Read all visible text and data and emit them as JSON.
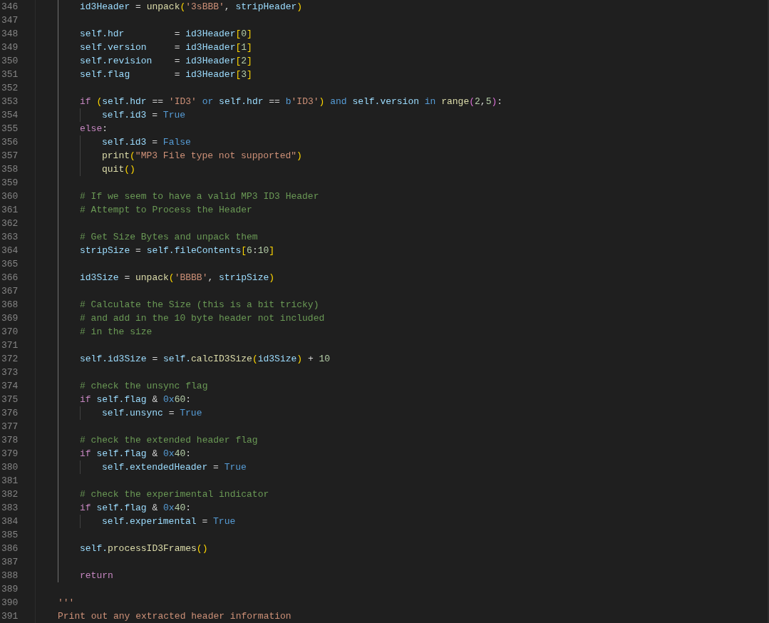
{
  "editor": {
    "lines": [
      {
        "children": [
          {
            "number": "346",
            "tokens": [
              {
                "text": "id3Header",
                "kind": "var"
              },
              {
                "text": " = ",
                "kind": "op"
              },
              {
                "text": "unpack",
                "kind": "func"
              },
              {
                "text": "(",
                "kind": "bracket"
              },
              {
                "text": "'3sBBB'",
                "kind": "string"
              },
              {
                "text": ", ",
                "kind": "op"
              },
              {
                "text": "stripHeader",
                "kind": "var"
              },
              {
                "text": ")",
                "kind": "bracket"
              }
            ]
          },
          {
            "number": "347"
          },
          {
            "number": "348",
            "tokens": [
              {
                "text": "self.hdr",
                "kind": "var"
              },
              {
                "text": "         = ",
                "kind": "op"
              },
              {
                "text": "id3Header",
                "kind": "var"
              },
              {
                "text": "[",
                "kind": "bracket"
              },
              {
                "text": "0",
                "kind": "number"
              },
              {
                "text": "]",
                "kind": "bracket"
              }
            ]
          },
          {
            "number": "349",
            "tokens": [
              {
                "text": "self.version",
                "kind": "var"
              },
              {
                "text": "     = ",
                "kind": "op"
              },
              {
                "text": "id3Header",
                "kind": "var"
              },
              {
                "text": "[",
                "kind": "bracket"
              },
              {
                "text": "1",
                "kind": "number"
              },
              {
                "text": "]",
                "kind": "bracket"
              }
            ]
          },
          {
            "number": "350",
            "tokens": [
              {
                "text": "self.revision",
                "kind": "var"
              },
              {
                "text": "    = ",
                "kind": "op"
              },
              {
                "text": "id3Header",
                "kind": "var"
              },
              {
                "text": "[",
                "kind": "bracket"
              },
              {
                "text": "2",
                "kind": "number"
              },
              {
                "text": "]",
                "kind": "bracket"
              }
            ]
          },
          {
            "number": "351",
            "tokens": [
              {
                "text": "self.flag",
                "kind": "var"
              },
              {
                "text": "        = ",
                "kind": "op"
              },
              {
                "text": "id3Header",
                "kind": "var"
              },
              {
                "text": "[",
                "kind": "bracket"
              },
              {
                "text": "3",
                "kind": "number"
              },
              {
                "text": "]",
                "kind": "bracket"
              }
            ]
          },
          {
            "number": "352"
          },
          {
            "number": "353",
            "tokens": [
              {
                "text": "if ",
                "kind": "control"
              },
              {
                "text": "(",
                "kind": "bracket"
              },
              {
                "text": "self.hdr",
                "kind": "var"
              },
              {
                "text": " == ",
                "kind": "op"
              },
              {
                "text": "'ID3' ",
                "kind": "string"
              },
              {
                "text": "or ",
                "kind": "keyword"
              },
              {
                "text": "self.hdr",
                "kind": "var"
              },
              {
                "text": " == ",
                "kind": "op"
              },
              {
                "text": "b",
                "kind": "keyword"
              },
              {
                "text": "'ID3'",
                "kind": "string"
              },
              {
                "text": ") ",
                "kind": "bracket"
              },
              {
                "text": "and ",
                "kind": "keyword"
              },
              {
                "text": "self.version ",
                "kind": "var"
              },
              {
                "text": "in ",
                "kind": "keyword"
              },
              {
                "text": "range",
                "kind": "func"
              },
              {
                "text": "(",
                "kind": "bracket2"
              },
              {
                "text": "2",
                "kind": "number"
              },
              {
                "text": ",",
                "kind": "op"
              },
              {
                "text": "5",
                "kind": "number"
              },
              {
                "text": ")",
                "kind": "bracket2"
              },
              {
                "text": ":",
                "kind": "op"
              }
            ],
            "children": [
              {
                "number": "354",
                "tokens": [
                  {
                    "text": "self.id3",
                    "kind": "var"
                  },
                  {
                    "text": " = ",
                    "kind": "op"
                  },
                  {
                    "text": "True",
                    "kind": "keyword"
                  }
                ]
              }
            ]
          },
          {
            "number": "355",
            "tokens": [
              {
                "text": "else",
                "kind": "control"
              },
              {
                "text": ":",
                "kind": "op"
              }
            ],
            "children": [
              {
                "number": "356",
                "tokens": [
                  {
                    "text": "self.id3",
                    "kind": "var"
                  },
                  {
                    "text": " = ",
                    "kind": "op"
                  },
                  {
                    "text": "False",
                    "kind": "keyword"
                  }
                ]
              },
              {
                "number": "357",
                "tokens": [
                  {
                    "text": "print",
                    "kind": "func"
                  },
                  {
                    "text": "(",
                    "kind": "bracket"
                  },
                  {
                    "text": "\"MP3 File type not supported\"",
                    "kind": "string"
                  },
                  {
                    "text": ")",
                    "kind": "bracket"
                  }
                ]
              },
              {
                "number": "358",
                "tokens": [
                  {
                    "text": "quit",
                    "kind": "func"
                  },
                  {
                    "text": "()",
                    "kind": "bracket"
                  }
                ]
              }
            ]
          },
          {
            "number": "359"
          },
          {
            "number": "360",
            "tokens": [
              {
                "text": "# If we seem to have a valid MP3 ID3 Header",
                "kind": "comment"
              }
            ]
          },
          {
            "number": "361",
            "tokens": [
              {
                "text": "# Attempt to Process the Header",
                "kind": "comment"
              }
            ]
          },
          {
            "number": "362"
          },
          {
            "number": "363",
            "tokens": [
              {
                "text": "# Get Size Bytes and unpack them",
                "kind": "comment"
              }
            ]
          },
          {
            "number": "364",
            "tokens": [
              {
                "text": "stripSize",
                "kind": "var"
              },
              {
                "text": " = ",
                "kind": "op"
              },
              {
                "text": "self.fileContents",
                "kind": "var"
              },
              {
                "text": "[",
                "kind": "bracket"
              },
              {
                "text": "6",
                "kind": "number"
              },
              {
                "text": ":",
                "kind": "op"
              },
              {
                "text": "10",
                "kind": "number"
              },
              {
                "text": "]",
                "kind": "bracket"
              }
            ]
          },
          {
            "number": "365"
          },
          {
            "number": "366",
            "tokens": [
              {
                "text": "id3Size",
                "kind": "var"
              },
              {
                "text": " = ",
                "kind": "op"
              },
              {
                "text": "unpack",
                "kind": "func"
              },
              {
                "text": "(",
                "kind": "bracket"
              },
              {
                "text": "'BBBB'",
                "kind": "string"
              },
              {
                "text": ", ",
                "kind": "op"
              },
              {
                "text": "stripSize",
                "kind": "var"
              },
              {
                "text": ")",
                "kind": "bracket"
              }
            ]
          },
          {
            "number": "367"
          },
          {
            "number": "368",
            "tokens": [
              {
                "text": "# Calculate the Size (this is a bit tricky)",
                "kind": "comment"
              }
            ]
          },
          {
            "number": "369",
            "tokens": [
              {
                "text": "# and add in the 10 byte header not included",
                "kind": "comment"
              }
            ]
          },
          {
            "number": "370",
            "tokens": [
              {
                "text": "# in the size",
                "kind": "comment"
              }
            ]
          },
          {
            "number": "371"
          },
          {
            "number": "372",
            "tokens": [
              {
                "text": "self.id3Size",
                "kind": "var"
              },
              {
                "text": " = ",
                "kind": "op"
              },
              {
                "text": "self.",
                "kind": "var"
              },
              {
                "text": "calcID3Size",
                "kind": "func"
              },
              {
                "text": "(",
                "kind": "bracket"
              },
              {
                "text": "id3Size",
                "kind": "var"
              },
              {
                "text": ")",
                "kind": "bracket"
              },
              {
                "text": " + ",
                "kind": "op"
              },
              {
                "text": "10",
                "kind": "number"
              }
            ]
          },
          {
            "number": "373"
          },
          {
            "number": "374",
            "tokens": [
              {
                "text": "# check the unsync flag",
                "kind": "comment"
              }
            ]
          },
          {
            "number": "375",
            "tokens": [
              {
                "text": "if ",
                "kind": "control"
              },
              {
                "text": "self.flag",
                "kind": "var"
              },
              {
                "text": " & ",
                "kind": "op"
              },
              {
                "text": "0x",
                "kind": "keyword"
              },
              {
                "text": "60",
                "kind": "number"
              },
              {
                "text": ":",
                "kind": "op"
              }
            ],
            "children": [
              {
                "number": "376",
                "tokens": [
                  {
                    "text": "self.unsync",
                    "kind": "var"
                  },
                  {
                    "text": " = ",
                    "kind": "op"
                  },
                  {
                    "text": "True",
                    "kind": "keyword"
                  }
                ]
              }
            ]
          },
          {
            "number": "377"
          },
          {
            "number": "378",
            "tokens": [
              {
                "text": "# check the extended header flag",
                "kind": "comment"
              }
            ]
          },
          {
            "number": "379",
            "tokens": [
              {
                "text": "if ",
                "kind": "control"
              },
              {
                "text": "self.flag",
                "kind": "var"
              },
              {
                "text": " & ",
                "kind": "op"
              },
              {
                "text": "0x",
                "kind": "keyword"
              },
              {
                "text": "40",
                "kind": "number"
              },
              {
                "text": ":",
                "kind": "op"
              }
            ],
            "children": [
              {
                "number": "380",
                "tokens": [
                  {
                    "text": "self.extendedHeader",
                    "kind": "var"
                  },
                  {
                    "text": " = ",
                    "kind": "op"
                  },
                  {
                    "text": "True",
                    "kind": "keyword"
                  }
                ]
              }
            ]
          },
          {
            "number": "381"
          },
          {
            "number": "382",
            "tokens": [
              {
                "text": "# check the experimental indicator",
                "kind": "comment"
              }
            ]
          },
          {
            "number": "383",
            "tokens": [
              {
                "text": "if ",
                "kind": "control"
              },
              {
                "text": "self.flag",
                "kind": "var"
              },
              {
                "text": " & ",
                "kind": "op"
              },
              {
                "text": "0x",
                "kind": "keyword"
              },
              {
                "text": "40",
                "kind": "number"
              },
              {
                "text": ":",
                "kind": "op"
              }
            ],
            "children": [
              {
                "number": "384",
                "tokens": [
                  {
                    "text": "self.experimental",
                    "kind": "var"
                  },
                  {
                    "text": " = ",
                    "kind": "op"
                  },
                  {
                    "text": "True",
                    "kind": "keyword"
                  }
                ]
              }
            ]
          },
          {
            "number": "385"
          },
          {
            "number": "386",
            "tokens": [
              {
                "text": "self.",
                "kind": "var"
              },
              {
                "text": "processID3Frames",
                "kind": "func"
              },
              {
                "text": "()",
                "kind": "bracket"
              }
            ]
          },
          {
            "number": "387"
          },
          {
            "number": "388",
            "tokens": [
              {
                "text": "return",
                "kind": "control"
              }
            ]
          }
        ]
      },
      {
        "number": "389"
      },
      {
        "number": "390",
        "tokens": [
          {
            "text": "'''",
            "kind": "string"
          }
        ]
      },
      {
        "number": "391",
        "tokens": [
          {
            "text": "Print out any extracted header information",
            "kind": "string"
          }
        ]
      }
    ]
  }
}
